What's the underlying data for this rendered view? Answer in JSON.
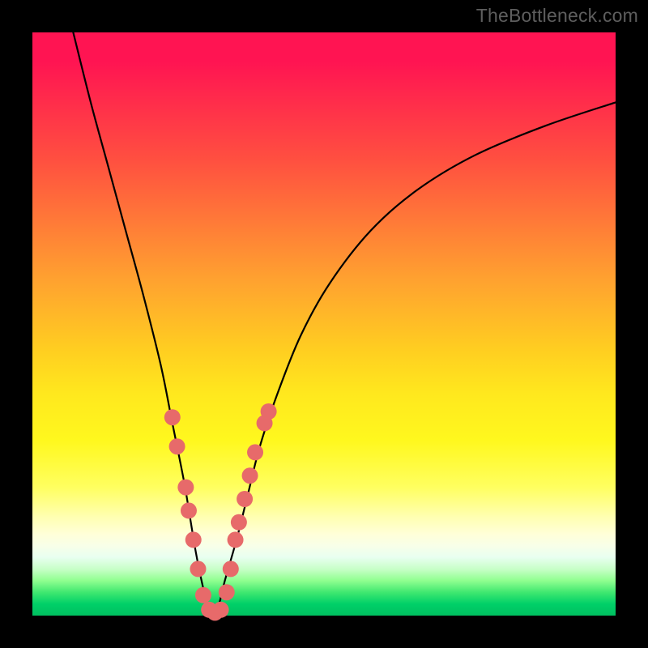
{
  "attribution": "TheBottleneck.com",
  "chart_data": {
    "type": "line",
    "title": "",
    "xlabel": "",
    "ylabel": "",
    "xlim": [
      0,
      100
    ],
    "ylim": [
      0,
      100
    ],
    "curve": {
      "x": [
        7,
        10,
        13,
        16,
        19,
        22,
        24,
        26,
        27,
        28,
        29,
        30,
        31,
        32,
        33,
        35,
        37,
        39,
        42,
        46,
        51,
        58,
        66,
        76,
        88,
        100
      ],
      "y": [
        100,
        88,
        77,
        66,
        55,
        43,
        33,
        23,
        17,
        11,
        6,
        2,
        0.5,
        2,
        6,
        13,
        21,
        29,
        38,
        48,
        57,
        66,
        73,
        79,
        84,
        88
      ]
    },
    "markers": [
      {
        "x": 24.0,
        "y": 34
      },
      {
        "x": 24.8,
        "y": 29
      },
      {
        "x": 26.3,
        "y": 22
      },
      {
        "x": 26.8,
        "y": 18
      },
      {
        "x": 27.6,
        "y": 13
      },
      {
        "x": 28.4,
        "y": 8
      },
      {
        "x": 29.3,
        "y": 3.5
      },
      {
        "x": 30.3,
        "y": 1
      },
      {
        "x": 31.3,
        "y": 0.5
      },
      {
        "x": 32.3,
        "y": 1
      },
      {
        "x": 33.3,
        "y": 4
      },
      {
        "x": 34.0,
        "y": 8
      },
      {
        "x": 34.8,
        "y": 13
      },
      {
        "x": 35.4,
        "y": 16
      },
      {
        "x": 36.4,
        "y": 20
      },
      {
        "x": 37.3,
        "y": 24
      },
      {
        "x": 38.2,
        "y": 28
      },
      {
        "x": 39.8,
        "y": 33
      },
      {
        "x": 40.5,
        "y": 35
      }
    ],
    "marker_style": {
      "color": "#e76a6a",
      "radius": 10
    },
    "gradient": {
      "stops": [
        {
          "offset": 0,
          "color": "#ff1452"
        },
        {
          "offset": 70,
          "color": "#fff81e"
        },
        {
          "offset": 88,
          "color": "#ffffd8"
        },
        {
          "offset": 100,
          "color": "#00c060"
        }
      ]
    }
  }
}
